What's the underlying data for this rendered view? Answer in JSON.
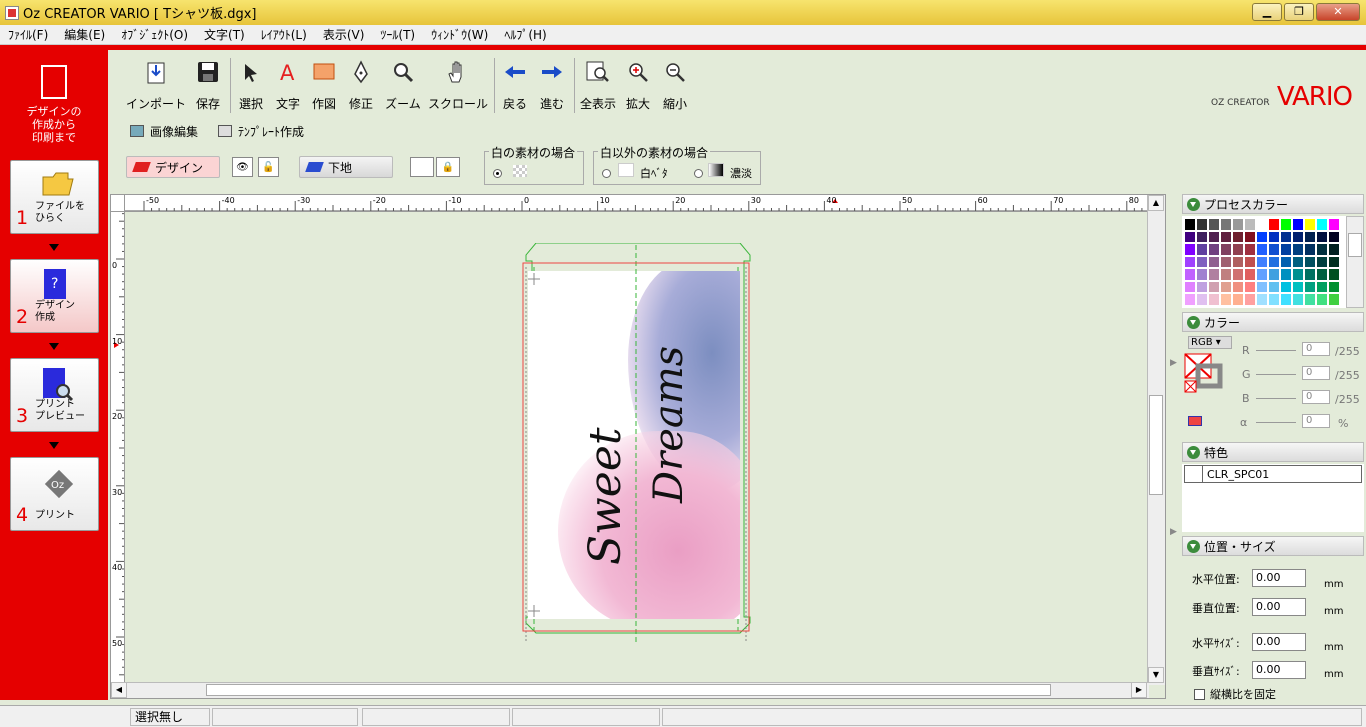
{
  "window": {
    "title": "Oz CREATOR VARIO [ Tシャツ板.dgx]"
  },
  "menu": [
    "ﾌｧｲﾙ(F)",
    "編集(E)",
    "ｵﾌﾞｼﾞｪｸﾄ(O)",
    "文字(T)",
    "ﾚｲｱｳﾄ(L)",
    "表示(V)",
    "ﾂｰﾙ(T)",
    "ｳｨﾝﾄﾞｳ(W)",
    "ﾍﾙﾌﾟ(H)"
  ],
  "sidebar": {
    "heading": "デザインの\n作成から\n印刷まで",
    "steps": [
      {
        "num": "1",
        "label": "ファイルを\nひらく"
      },
      {
        "num": "2",
        "label": "デザイン\n作成"
      },
      {
        "num": "3",
        "label": "プリント\nプレビュー"
      },
      {
        "num": "4",
        "label": "プリント"
      }
    ]
  },
  "toolbar": {
    "import": "インポート",
    "save": "保存",
    "select": "選択",
    "text": "文字",
    "draw": "作図",
    "edit": "修正",
    "zoom": "ズーム",
    "scroll": "スクロール",
    "back": "戻る",
    "forward": "進む",
    "fit": "全表示",
    "zoom_in": "拡大",
    "zoom_out": "縮小"
  },
  "logo": {
    "brand_small": "OZ CREATOR",
    "brand": "VARIO"
  },
  "subbar": {
    "image_edit": "画像編集",
    "template": "ﾃﾝﾌﾟﾚｰﾄ作成"
  },
  "layers": {
    "design": "デザイン",
    "base": "下地",
    "white_group_title": "白の素材の場合",
    "other_group_title": "白以外の素材の場合",
    "white_solid": "白ﾍﾞﾀ",
    "shading": "濃淡"
  },
  "ruler": {
    "h_ticks": [
      "-50",
      "-40",
      "-30",
      "-20",
      "-10",
      "0",
      "10",
      "20",
      "30",
      "40",
      "50",
      "60",
      "70",
      "80"
    ],
    "v_ticks": [
      "0",
      "10",
      "20",
      "30",
      "40",
      "50"
    ]
  },
  "artwork": {
    "word1": "Sweet",
    "word2": "Dreams"
  },
  "panels": {
    "process_color": "プロセスカラー",
    "color": "カラー",
    "color_mode": "RGB",
    "channels": [
      {
        "label": "R",
        "value": "0",
        "max": "/255"
      },
      {
        "label": "G",
        "value": "0",
        "max": "/255"
      },
      {
        "label": "B",
        "value": "0",
        "max": "/255"
      },
      {
        "label": "α",
        "value": "0",
        "max": "%"
      }
    ],
    "spot": "特色",
    "spot_item": "CLR_SPC01",
    "position_size": "位置・サイズ",
    "h_pos_label": "水平位置:",
    "h_pos": "0.00",
    "v_pos_label": "垂直位置:",
    "v_pos": "0.00",
    "h_size_label": "水平ｻｲｽﾞ:",
    "h_size": "0.00",
    "v_size_label": "垂直ｻｲｽﾞ:",
    "v_size": "0.00",
    "unit": "mm",
    "lock_ratio": "縦横比を固定"
  },
  "palette_colors": [
    "#000000",
    "#333333",
    "#555555",
    "#777777",
    "#999999",
    "#bbbbbb",
    "#ffffff",
    "#ff0000",
    "#00ff00",
    "#0000ff",
    "#ffff00",
    "#00ffff",
    "#ff00ff",
    "#400080",
    "#402060",
    "#502050",
    "#602040",
    "#702030",
    "#801020",
    "#0040ff",
    "#0030c0",
    "#003090",
    "#002070",
    "#002050",
    "#001040",
    "#000020",
    "#8000ff",
    "#6040a0",
    "#704080",
    "#804060",
    "#904050",
    "#a03040",
    "#2060ff",
    "#1050d0",
    "#0040a0",
    "#004080",
    "#003060",
    "#003040",
    "#002020",
    "#a040ff",
    "#8060c0",
    "#906090",
    "#a06070",
    "#b06060",
    "#c05050",
    "#4080ff",
    "#2070e0",
    "#0060b0",
    "#006080",
    "#005060",
    "#004040",
    "#003020",
    "#c060ff",
    "#a080d0",
    "#b080a0",
    "#c08080",
    "#d07070",
    "#e06060",
    "#60a0ff",
    "#40a0e0",
    "#0090c0",
    "#009090",
    "#007060",
    "#006040",
    "#005020",
    "#e080ff",
    "#c0a0e0",
    "#d0a0b0",
    "#e0a090",
    "#f09080",
    "#ff8080",
    "#80c0ff",
    "#60c0f0",
    "#00c0e0",
    "#00c0c0",
    "#00a080",
    "#00a060",
    "#009030",
    "#f0a0ff",
    "#e0c0f0",
    "#f0c0d0",
    "#ffc0a0",
    "#ffb090",
    "#ffa0a0",
    "#a0e0ff",
    "#80e0ff",
    "#40e0ff",
    "#40e0e0",
    "#40e0a0",
    "#40e080",
    "#40d040"
  ],
  "status": {
    "selection": "選択無し"
  }
}
